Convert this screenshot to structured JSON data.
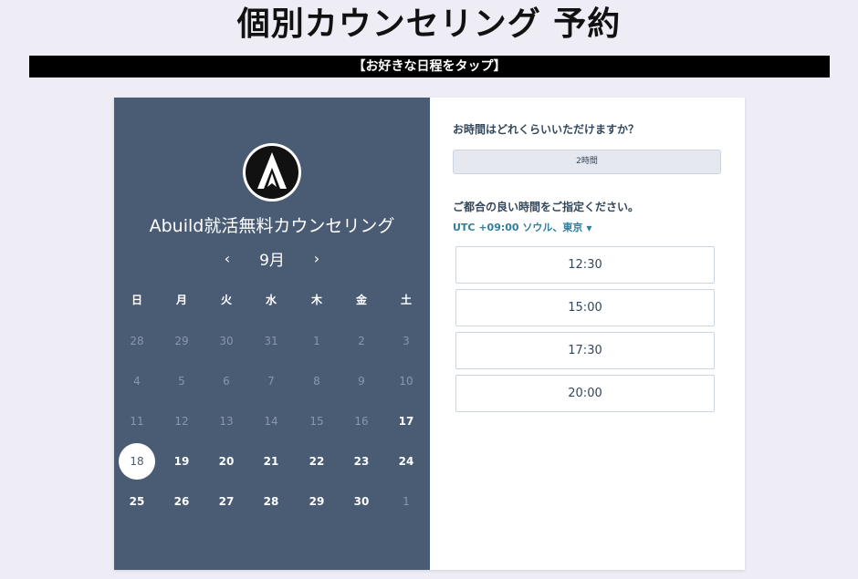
{
  "page": {
    "title": "個別カウンセリング 予約",
    "banner": "【お好きな日程をタップ】"
  },
  "calendar": {
    "meeting_name": "Abuild就活無料カウンセリング",
    "month": "9月",
    "prev_icon": "‹",
    "next_icon": "›",
    "weekdays": [
      "日",
      "月",
      "火",
      "水",
      "木",
      "金",
      "土"
    ],
    "weeks": [
      [
        "28",
        "29",
        "30",
        "31",
        "1",
        "2",
        "3"
      ],
      [
        "4",
        "5",
        "6",
        "7",
        "8",
        "9",
        "10"
      ],
      [
        "11",
        "12",
        "13",
        "14",
        "15",
        "16",
        "17"
      ],
      [
        "18",
        "19",
        "20",
        "21",
        "22",
        "23",
        "24"
      ],
      [
        "25",
        "26",
        "27",
        "28",
        "29",
        "30",
        "1"
      ]
    ],
    "selected_day": "18"
  },
  "booking": {
    "duration_question": "お時間はどれくらいいただけますか？",
    "duration_value": "2時間",
    "time_question": "ご都合の良い時間をご指定ください。",
    "timezone": "UTC +09:00 ソウル、東京",
    "timezone_caret": "▼",
    "slots": [
      "12:30",
      "15:00",
      "17:30",
      "20:00"
    ]
  },
  "colors": {
    "panel": "#4a5b74",
    "accent_link": "#2f7f9e",
    "page_bg": "#eeedf6"
  }
}
